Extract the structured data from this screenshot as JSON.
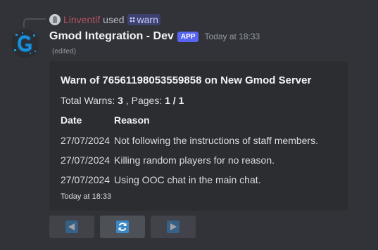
{
  "interaction": {
    "user_name": "Linventif",
    "used_word": "used",
    "command": "warn"
  },
  "message": {
    "bot_name": "Gmod Integration - Dev",
    "app_badge": "APP",
    "timestamp": "Today at 18:33",
    "edited_label": "(edited)"
  },
  "embed": {
    "title": "Warn of 76561198053559858 on New Gmod Server",
    "summary": {
      "total_label": "Total Warns: ",
      "total_value": "3",
      "pages_label": " , Pages: ",
      "pages_value": "1 / 1"
    },
    "columns": {
      "date": "Date",
      "reason": "Reason"
    },
    "rows": [
      {
        "date": "27/07/2024",
        "reason": "Not following the instructions of staff members."
      },
      {
        "date": "27/07/2024",
        "reason": "Killing random players for no reason."
      },
      {
        "date": "27/07/2024",
        "reason": "Using OOC chat in the main chat."
      }
    ],
    "footer": "Today at 18:33"
  },
  "buttons": [
    {
      "icon": "arrow-left-icon",
      "disabled": true
    },
    {
      "icon": "refresh-icon",
      "disabled": false
    },
    {
      "icon": "arrow-right-icon",
      "disabled": true
    }
  ],
  "colors": {
    "background": "#323339",
    "embed_background": "#2b2d31",
    "user_name": "#b4525c",
    "app_badge": "#5865f2",
    "button_icon": "#3b88c3"
  }
}
